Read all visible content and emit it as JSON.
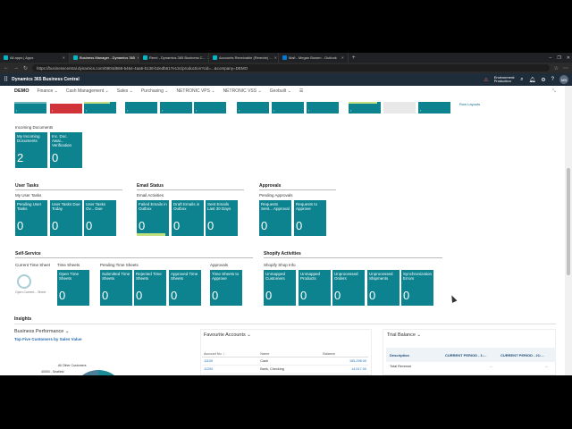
{
  "browser": {
    "tabs": [
      {
        "label": "All apps | Apps",
        "active": false
      },
      {
        "label": "Business Manager - Dynamics 365",
        "active": true
      },
      {
        "label": "Remi - Dynamics 365 Business C...",
        "active": false
      },
      {
        "label": "Accounts Receivable (Remote) ...",
        "active": false
      },
      {
        "label": "Mail - Megan Bowen - Outlook",
        "active": false
      }
    ],
    "url": "https://businesscentral.dynamics.com/0804d658-5464-4aa5-b138-b2edb617e13c/production?cid=...&company=DEMO",
    "window_controls": [
      "–",
      "❐",
      "✕"
    ]
  },
  "app": {
    "title": "Dynamics 365 Business Central",
    "environment_line1": "Environment:",
    "environment_line2": "Production",
    "avatar_initials": "MB"
  },
  "nav": {
    "company": "DEMO",
    "items": [
      "Finance",
      "Cash Management",
      "Sales",
      "Purchasing",
      "NETRONIC VPS",
      "NETRONIC VSS",
      "Geobuilt"
    ],
    "more": "☰"
  },
  "top_row": {
    "link": "Row Layouts"
  },
  "incoming": {
    "title": "Incoming Documents",
    "tiles": [
      {
        "label": "My Incoming Documents",
        "value": "2"
      },
      {
        "label": "Inc. Doc. Awai... Verification",
        "value": "0"
      }
    ]
  },
  "user_tasks": {
    "title": "User Tasks",
    "group": "My User Tasks",
    "tiles": [
      {
        "label": "Pending User Tasks",
        "value": "0"
      },
      {
        "label": "User Tasks Due Today",
        "value": "0"
      },
      {
        "label": "User Tasks Ov... Due",
        "value": "0"
      }
    ]
  },
  "email_status": {
    "title": "Email Status",
    "group": "Email Activities",
    "tiles": [
      {
        "label": "Failed Emails in Outbox",
        "value": "0"
      },
      {
        "label": "Draft Emails in Outbox",
        "value": "0"
      },
      {
        "label": "Sent Emails Last 30 Days",
        "value": "0"
      }
    ]
  },
  "approvals": {
    "title": "Approvals",
    "group": "Pending Approvals",
    "tiles": [
      {
        "label": "Requests Sent... Approval",
        "value": "0"
      },
      {
        "label": "Requests to Approve",
        "value": "0"
      }
    ]
  },
  "self_service": {
    "title": "Self-Service",
    "current_time_sheet": "Current Time Sheet",
    "ring_label": "Open Current... Sheet",
    "time_sheets": "Time Sheets",
    "pending_time_sheets": "Pending Time Sheets",
    "approvals": "Approvals",
    "tiles": [
      {
        "label": "Open Time Sheets",
        "value": "0"
      },
      {
        "label": "Submitted Time Sheets",
        "value": "0"
      },
      {
        "label": "Rejected Time Sheets",
        "value": "0"
      },
      {
        "label": "Approved Time Sheets",
        "value": "0"
      },
      {
        "label": "Time Sheets to Approve",
        "value": "0"
      }
    ]
  },
  "shopify": {
    "title": "Shopify Activities",
    "group": "Shopify Shop Info",
    "tiles": [
      {
        "label": "Unmapped Customers",
        "value": "0"
      },
      {
        "label": "Unmapped Products",
        "value": "0"
      },
      {
        "label": "Unprocessed Orders",
        "value": "0"
      },
      {
        "label": "Unprocessed Shipments",
        "value": "0"
      },
      {
        "label": "Synchronization Errors",
        "value": "0"
      }
    ]
  },
  "insights": {
    "title": "Insights",
    "business_performance": "Business Performance",
    "top_customers": "Top Five Customers by Sales Value",
    "label_all_other": "All Other Customers",
    "label_seafield": "40000 - Seafield",
    "favourite_accounts": "Favourite Accounts",
    "fav_columns": [
      "Account No. ↑",
      "Name",
      "Balance"
    ],
    "fav_rows": [
      {
        "no": "11100",
        "name": "Cash",
        "balance": "155,298.00"
      },
      {
        "no": "11200",
        "name": "Bank, Checking",
        "balance": "14,517.00"
      }
    ],
    "trial_balance": "Trial Balance",
    "tb_columns": [
      "Description",
      "CURRENT PERIOD - 1:...",
      "CURRENT PERIOD - 21:..."
    ],
    "tb_rows": [
      {
        "description": "Total Revenue",
        "c1": "...",
        "c2": "..."
      }
    ]
  },
  "colors": {
    "tile": "#0d8390",
    "header": "#1f2d3a",
    "alert": "#d13438"
  }
}
